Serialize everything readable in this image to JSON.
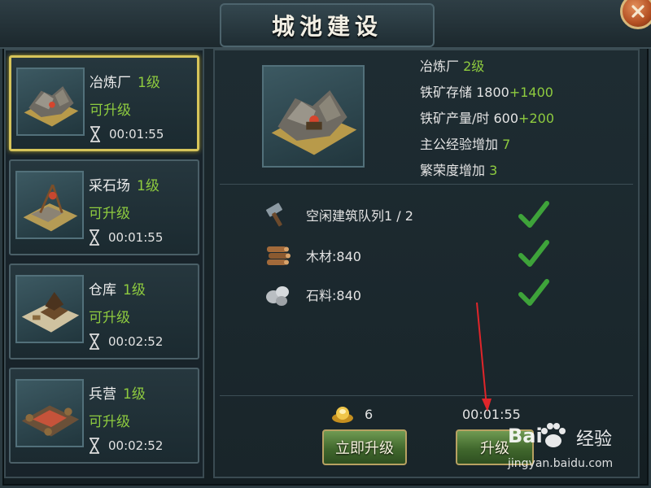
{
  "title": "城池建设",
  "buildings": [
    {
      "name": "冶炼厂",
      "level": "1级",
      "status": "可升级",
      "time": "00:01:55"
    },
    {
      "name": "采石场",
      "level": "1级",
      "status": "可升级",
      "time": "00:01:55"
    },
    {
      "name": "仓库",
      "level": "1级",
      "status": "可升级",
      "time": "00:02:52"
    },
    {
      "name": "兵营",
      "level": "1级",
      "status": "可升级",
      "time": "00:02:52"
    }
  ],
  "detail": {
    "name": "冶炼厂",
    "level": "2级",
    "storage_label": "铁矿存储",
    "storage_base": "1800",
    "storage_bonus": "+1400",
    "output_label": "铁矿产量/时",
    "output_base": "600",
    "output_bonus": "+200",
    "exp_label": "主公经验增加",
    "exp_value": "7",
    "prosperity_label": "繁荣度增加",
    "prosperity_value": "3"
  },
  "requirements": [
    {
      "icon": "hammer-icon",
      "text": "空闲建筑队列1 / 2"
    },
    {
      "icon": "wood-icon",
      "text": "木材:840"
    },
    {
      "icon": "stone-icon",
      "text": "石料:840"
    }
  ],
  "footer": {
    "gold_count": "6",
    "upgrade_time": "00:01:55",
    "instant_label": "立即升级",
    "upgrade_label": "升级"
  },
  "watermark": {
    "brand": "Bai",
    "brand_cn": "经验",
    "url": "jingyan.baidu.com"
  },
  "colors": {
    "accent_green": "#8ecb3f",
    "selected_border": "#d6c45a",
    "annotation_arrow": "#e0252a"
  }
}
